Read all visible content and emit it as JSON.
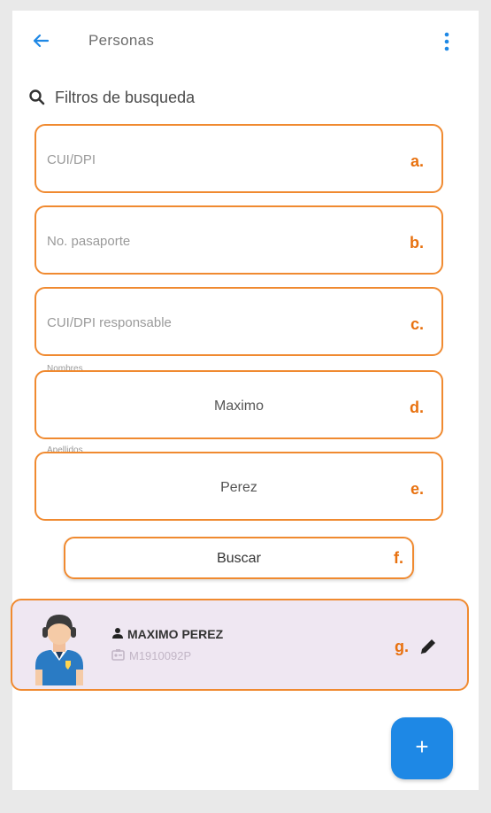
{
  "appbar": {
    "title": "Personas"
  },
  "filters": {
    "label": "Filtros de busqueda"
  },
  "fields": [
    {
      "placeholder": "CUI/DPI",
      "value": "",
      "tag": "a."
    },
    {
      "placeholder": "No. pasaporte",
      "value": "",
      "tag": "b."
    },
    {
      "placeholder": "CUI/DPI responsable",
      "value": "",
      "tag": "c."
    },
    {
      "label": "Nombres",
      "value": "Maximo",
      "tag": "d."
    },
    {
      "label": "Apellidos",
      "value": "Perez",
      "tag": "e."
    }
  ],
  "search_button": {
    "label": "Buscar",
    "tag": "f."
  },
  "result": {
    "name": "MAXIMO PEREZ",
    "id": "M1910092P",
    "tag": "g."
  },
  "fab": {
    "label": "+"
  },
  "colors": {
    "accent": "#f08a30",
    "tag": "#e8710f",
    "primary": "#1e88e5",
    "card_bg": "#efe7f2"
  }
}
